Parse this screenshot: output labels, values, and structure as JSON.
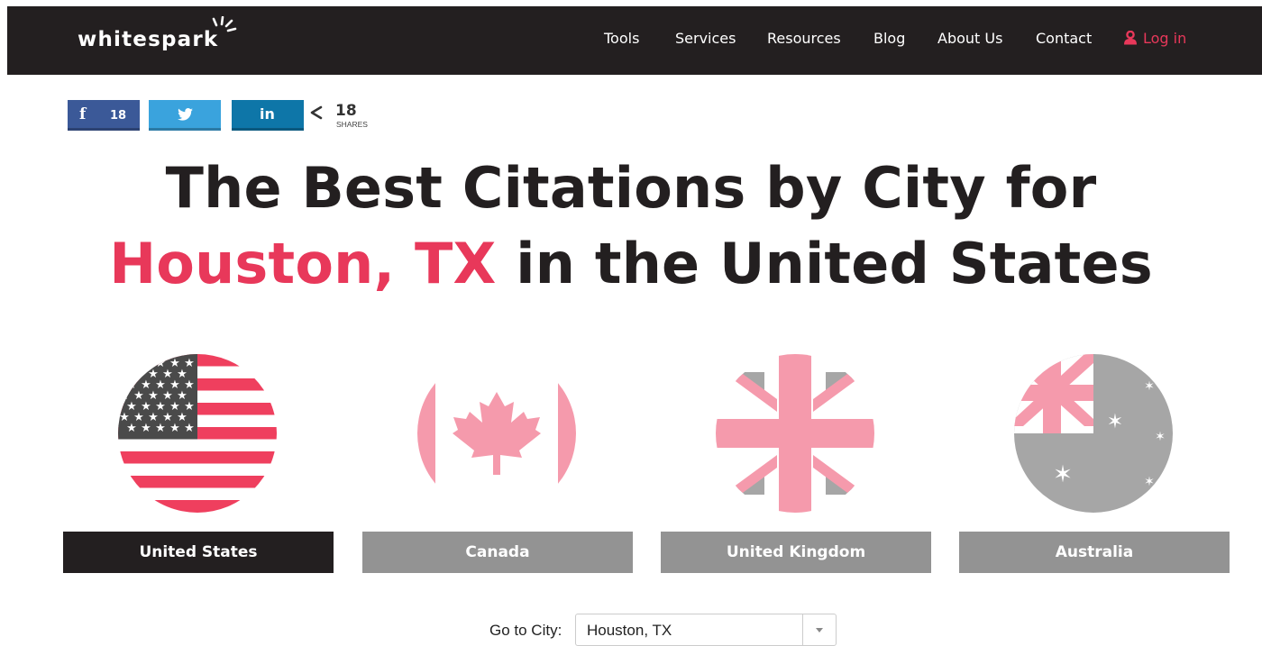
{
  "header": {
    "logo_text": "whitespark",
    "nav": [
      "Tools",
      "Services",
      "Resources",
      "Blog",
      "About Us",
      "Contact"
    ],
    "login_label": "Log in",
    "colors": {
      "bar": "#231f20",
      "accent": "#e8385a"
    }
  },
  "share": {
    "facebook_count": "18",
    "total_count": "18",
    "total_label": "SHARES",
    "facebook_icon": "facebook-icon",
    "twitter_icon": "twitter-icon",
    "linkedin_icon": "linkedin-icon",
    "linkedin_glyph": "in",
    "facebook_glyph": "f"
  },
  "title": {
    "line1": "The Best Citations by City for",
    "city": "Houston, TX",
    "line2_rest": " in the United States"
  },
  "countries": [
    {
      "label": "United States",
      "flag": "us-flag-icon",
      "active": true
    },
    {
      "label": "Canada",
      "flag": "canada-flag-icon",
      "active": false
    },
    {
      "label": "United Kingdom",
      "flag": "uk-flag-icon",
      "active": false
    },
    {
      "label": "Australia",
      "flag": "australia-flag-icon",
      "active": false
    }
  ],
  "city_select": {
    "label": "Go to City:",
    "value": "Houston, TX"
  }
}
